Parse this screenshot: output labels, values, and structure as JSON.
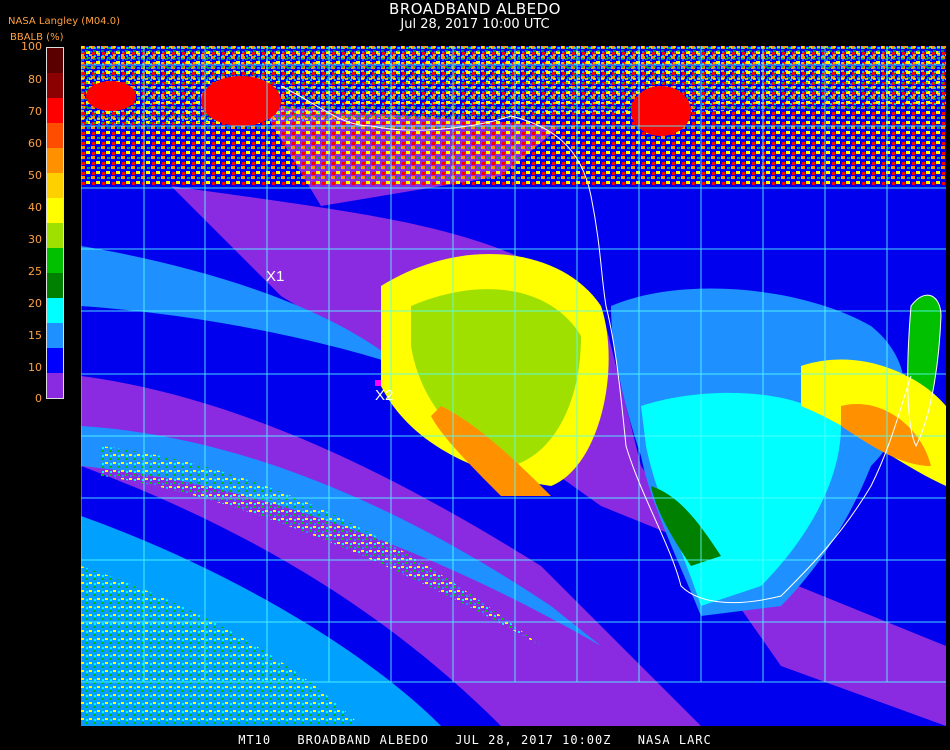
{
  "header": {
    "title": "BROADBAND ALBEDO",
    "datetime": "Jul 28, 2017 10:00 UTC",
    "source": "NASA Langley (M04.0)",
    "product": "BBALB (%)"
  },
  "colorbar": {
    "ticks": [
      "100",
      "80",
      "70",
      "60",
      "50",
      "40",
      "30",
      "25",
      "20",
      "15",
      "10",
      "0"
    ],
    "colors": [
      "#5a0000",
      "#8b0000",
      "#ff0000",
      "#ff4d00",
      "#ff9000",
      "#ffd000",
      "#ffff00",
      "#a0e000",
      "#00c000",
      "#008000",
      "#00ffff",
      "#1e90ff",
      "#0000ff",
      "#8a2be2"
    ]
  },
  "markers": {
    "x1": "X1",
    "x2": "X2"
  },
  "footer": {
    "code": "MT10",
    "product": "BROADBAND ALBEDO",
    "date": "JUL 28, 2017 10:00Z",
    "org": "NASA LARC"
  }
}
